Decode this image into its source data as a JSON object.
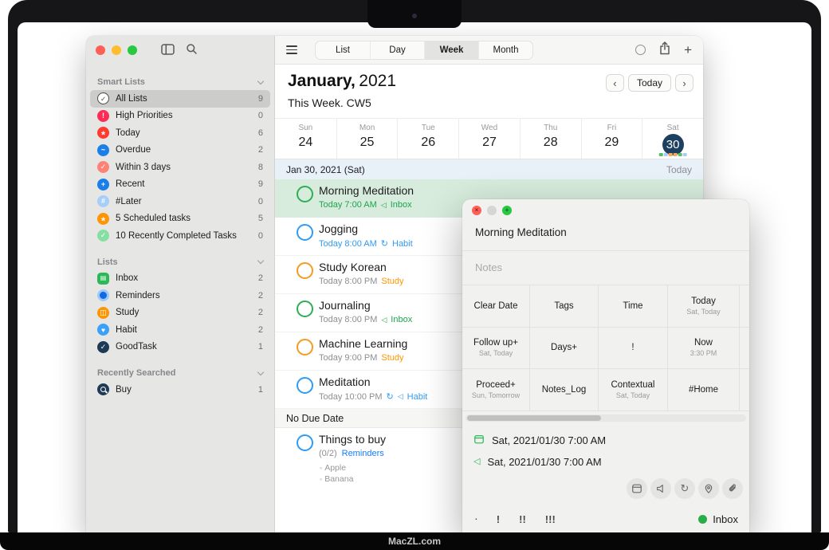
{
  "frame": {
    "watermark": "MacZL.com"
  },
  "colors": {
    "accent_green": "#27ae4e",
    "accent_blue": "#2e9bf5",
    "accent_orange": "#ff9500",
    "selected_day_circle": "#1e4060",
    "highlight_row_green": "#d7ecdd",
    "date_row_blue": "#e8f1f8",
    "reminders_blue": "#147efb",
    "traffic_red": "#ff5f57",
    "traffic_yellow": "#febc2e",
    "traffic_green": "#28c840"
  },
  "sidebar": {
    "sections": [
      {
        "label": "Smart Lists"
      },
      {
        "label": "Lists"
      },
      {
        "label": "Recently Searched"
      }
    ],
    "smart": [
      {
        "label": "All Lists",
        "count": "9",
        "icon": "checkmark-circle-outline"
      },
      {
        "label": "High Priorities",
        "count": "0",
        "icon": "exclamation-circle"
      },
      {
        "label": "Today",
        "count": "6",
        "icon": "asterisk-circle"
      },
      {
        "label": "Overdue",
        "count": "2",
        "icon": "wave-circle"
      },
      {
        "label": "Within 3 days",
        "count": "8",
        "icon": "checkmark-circle"
      },
      {
        "label": "Recent",
        "count": "9",
        "icon": "plus-circle"
      },
      {
        "label": "#Later",
        "count": "0",
        "icon": "hash-circle"
      },
      {
        "label": "5 Scheduled tasks",
        "count": "5",
        "icon": "asterisk-circle"
      },
      {
        "label": "10 Recently Completed Tasks",
        "count": "0",
        "icon": "checkmark-circle"
      }
    ],
    "lists": [
      {
        "label": "Inbox",
        "count": "2",
        "icon": "inbox-tray"
      },
      {
        "label": "Reminders",
        "count": "2",
        "icon": "reminders-dot"
      },
      {
        "label": "Study",
        "count": "2",
        "icon": "book"
      },
      {
        "label": "Habit",
        "count": "2",
        "icon": "heart"
      },
      {
        "label": "GoodTask",
        "count": "1",
        "icon": "checkmark-circle"
      }
    ],
    "searched": [
      {
        "label": "Buy",
        "count": "1",
        "icon": "magnifier-circle"
      }
    ]
  },
  "toolbar": {
    "views": [
      {
        "label": "List"
      },
      {
        "label": "Day"
      },
      {
        "label": "Week",
        "selected": true
      },
      {
        "label": "Month"
      }
    ]
  },
  "header": {
    "month": "January,",
    "year": "2021",
    "subtitle": "This Week. CW5",
    "today_button": "Today"
  },
  "calendar": {
    "days": [
      {
        "name": "Sun",
        "num": "24"
      },
      {
        "name": "Mon",
        "num": "25"
      },
      {
        "name": "Tue",
        "num": "26"
      },
      {
        "name": "Wed",
        "num": "27"
      },
      {
        "name": "Thu",
        "num": "28"
      },
      {
        "name": "Fri",
        "num": "29"
      },
      {
        "name": "Sat",
        "num": "30",
        "selected": true
      }
    ],
    "date_row": {
      "date": "Jan 30, 2021 (Sat)",
      "right": "Today"
    },
    "no_due_date": "No Due Date"
  },
  "tasks": [
    {
      "title": "Morning Meditation",
      "time": "Today 7:00 AM",
      "list": "Inbox",
      "icons": [
        "alert"
      ]
    },
    {
      "title": "Jogging",
      "time": "Today 8:00 AM",
      "list": "Habit",
      "icons": [
        "repeat"
      ]
    },
    {
      "title": "Study Korean",
      "time": "Today 8:00 PM",
      "list": "Study",
      "icons": []
    },
    {
      "title": "Journaling",
      "time": "Today 8:00 PM",
      "list": "Inbox",
      "icons": [
        "alert"
      ]
    },
    {
      "title": "Machine Learning",
      "time": "Today 9:00 PM",
      "list": "Study",
      "icons": []
    },
    {
      "title": "Meditation",
      "time": "Today 10:00 PM",
      "list": "Habit",
      "icons": [
        "repeat",
        "alert"
      ]
    }
  ],
  "no_date_task": {
    "title": "Things to buy",
    "progress": "(0/2)",
    "list": "Reminders",
    "subtasks": [
      "Apple",
      "Banana"
    ]
  },
  "popup": {
    "title": "Morning Meditation",
    "notes_placeholder": "Notes",
    "grid": [
      {
        "label": "Clear Date",
        "sub": ""
      },
      {
        "label": "Tags",
        "sub": ""
      },
      {
        "label": "Time",
        "sub": ""
      },
      {
        "label": "Today",
        "sub": "Sat, Today"
      },
      {
        "label": "Follow up+",
        "sub": "Sat, Today"
      },
      {
        "label": "Days+",
        "sub": ""
      },
      {
        "label": "!",
        "sub": ""
      },
      {
        "label": "Now",
        "sub": "3:30 PM"
      },
      {
        "label": "Proceed+",
        "sub": "Sun, Tomorrow"
      },
      {
        "label": "Notes_Log",
        "sub": ""
      },
      {
        "label": "Contextual",
        "sub": "Sat, Today"
      },
      {
        "label": "#Home",
        "sub": ""
      }
    ],
    "due_date": "Sat, 2021/01/30 7:00 AM",
    "alert_date": "Sat, 2021/01/30 7:00 AM",
    "action_icons": [
      "calendar",
      "alert",
      "repeat",
      "location",
      "attachment"
    ],
    "priorities": [
      ".",
      "!",
      "!!",
      "!!!"
    ],
    "list_name": "Inbox"
  }
}
